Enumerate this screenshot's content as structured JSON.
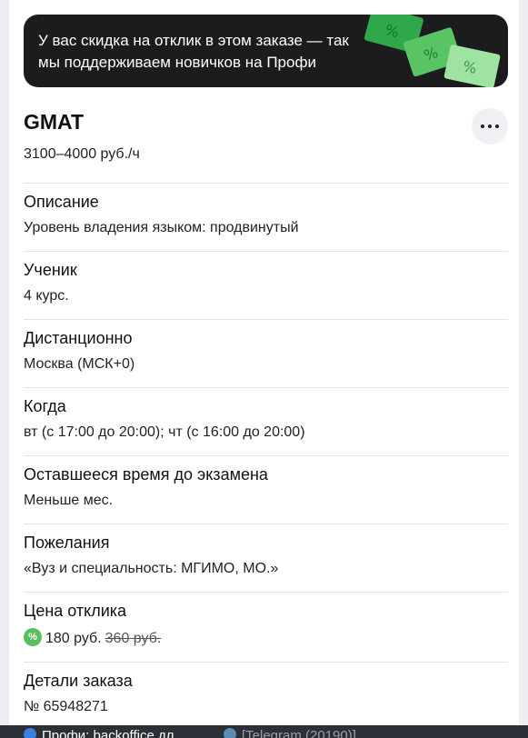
{
  "promo": {
    "text": "У вас скидка на отклик в этом заказе — так мы поддерживаем новичков на Профи",
    "icon": "discount-tickets-icon"
  },
  "order": {
    "title": "GMAT",
    "price_range": "3100–4000 руб./ч",
    "more_icon": "more-dots-icon"
  },
  "sections": [
    {
      "label": "Описание",
      "value": "Уровень владения языком: продвинутый"
    },
    {
      "label": "Ученик",
      "value": "4 курс."
    },
    {
      "label": "Дистанционно",
      "value": "Москва (МСК+0)"
    },
    {
      "label": "Когда",
      "value": "вт (с 17:00 до 20:00); чт (с 16:00 до 20:00)"
    },
    {
      "label": "Оставшееся время до экзамена",
      "value": "Меньше мес."
    },
    {
      "label": "Пожелания",
      "value": "«Вуз и специальность: МГИМО, МО.»"
    },
    {
      "label": "Цена отклика",
      "value": "180 руб.",
      "old_value": "360 руб.",
      "icon": "percent-badge-icon"
    },
    {
      "label": "Детали заказа",
      "value": "№ 65948271"
    }
  ],
  "taskbar": {
    "items": [
      {
        "label": "Профи: backoffice дл...",
        "icon": "browser-icon"
      },
      {
        "label": "[Telegram (20190)]",
        "icon": "telegram-icon"
      }
    ]
  },
  "colors": {
    "promo_bg": "#1c1c1e",
    "accent_green": "#5bbf5d",
    "divider": "#e2e4e8"
  }
}
